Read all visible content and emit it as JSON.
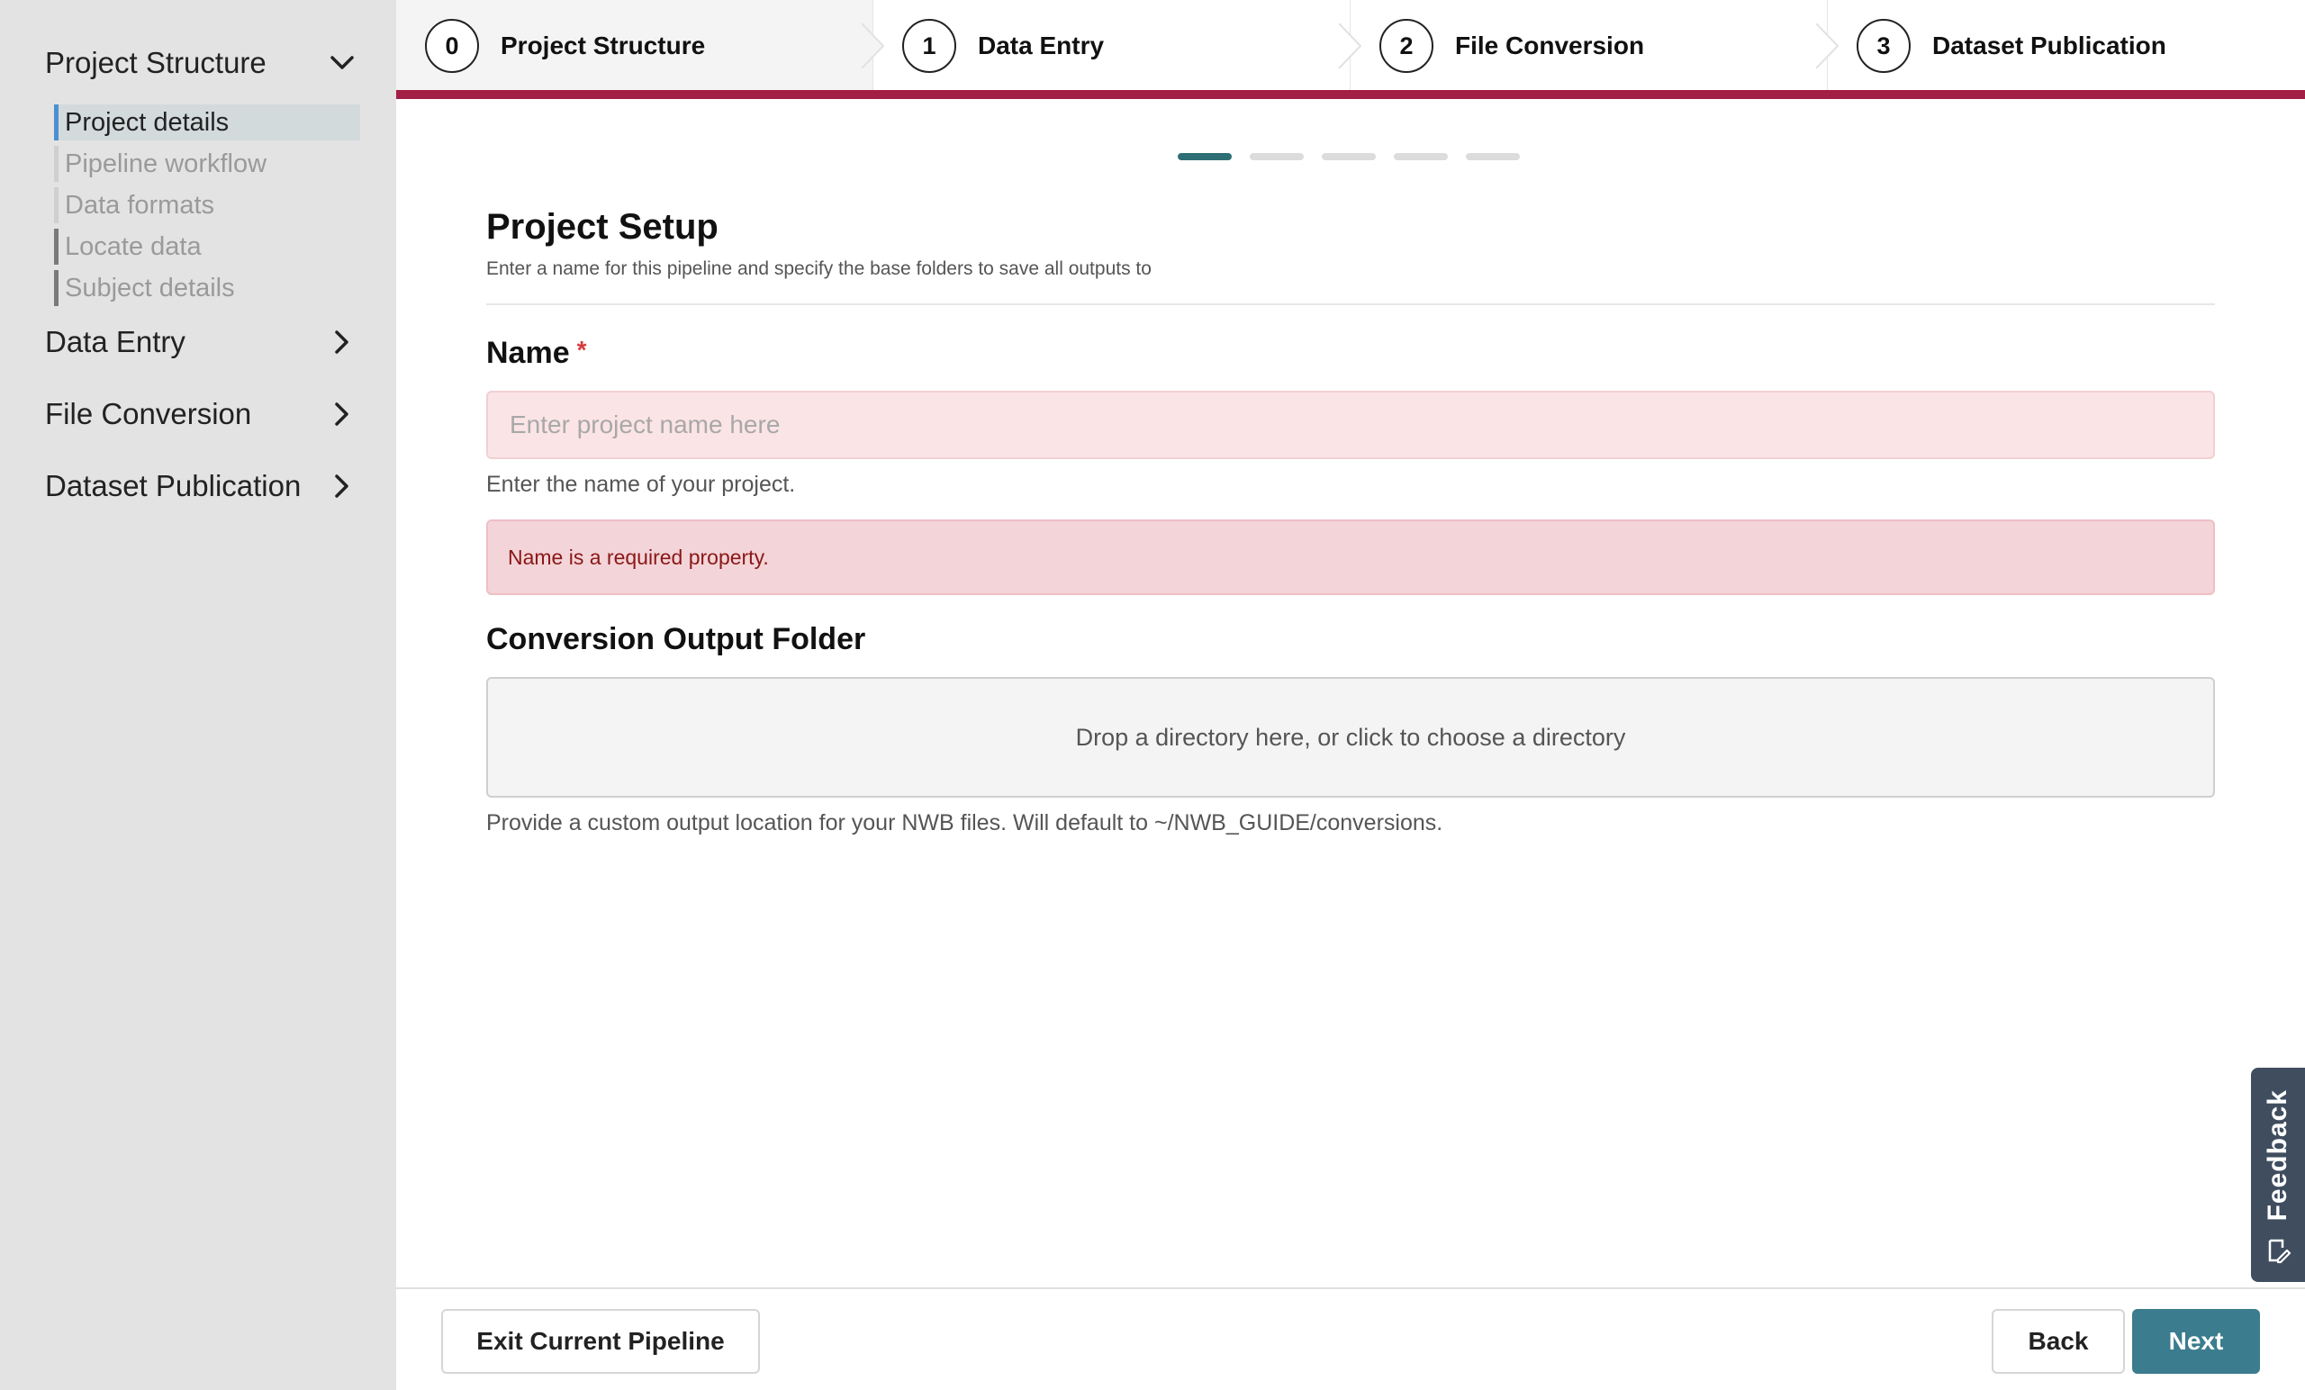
{
  "sidebar": {
    "sections": [
      {
        "label": "Project Structure",
        "expanded": true
      },
      {
        "label": "Data Entry",
        "expanded": false
      },
      {
        "label": "File Conversion",
        "expanded": false
      },
      {
        "label": "Dataset Publication",
        "expanded": false
      }
    ],
    "items": [
      {
        "label": "Project details",
        "state": "active"
      },
      {
        "label": "Pipeline workflow",
        "state": "pending"
      },
      {
        "label": "Data formats",
        "state": "pending"
      },
      {
        "label": "Locate data",
        "state": "visited"
      },
      {
        "label": "Subject details",
        "state": "visited"
      }
    ]
  },
  "stepper": {
    "steps": [
      {
        "num": "0",
        "label": "Project Structure"
      },
      {
        "num": "1",
        "label": "Data Entry"
      },
      {
        "num": "2",
        "label": "File Conversion"
      },
      {
        "num": "3",
        "label": "Dataset Publication"
      }
    ],
    "current_step": 0
  },
  "pager": {
    "total": 5,
    "current": 1
  },
  "page": {
    "title": "Project Setup",
    "subtitle": "Enter a name for this pipeline and specify the base folders to save all outputs to"
  },
  "form": {
    "name": {
      "label": "Name",
      "required_mark": "*",
      "value": "",
      "placeholder": "Enter project name here",
      "help": "Enter the name of your project.",
      "error": "Name is a required property."
    },
    "output_folder": {
      "label": "Conversion Output Folder",
      "dropzone_text": "Drop a directory here, or click to choose a directory",
      "help": "Provide a custom output location for your NWB files. Will default to ~/NWB_GUIDE/conversions."
    }
  },
  "footer": {
    "exit_label": "Exit Current Pipeline",
    "back_label": "Back",
    "next_label": "Next"
  },
  "feedback": {
    "label": "Feedback"
  },
  "colors": {
    "accent_bar": "#a31f45",
    "primary_button": "#3b7c8e",
    "pager_active": "#2e6f76",
    "error_bg": "#f3d4d8",
    "active_item_marker": "#4a90d0"
  }
}
